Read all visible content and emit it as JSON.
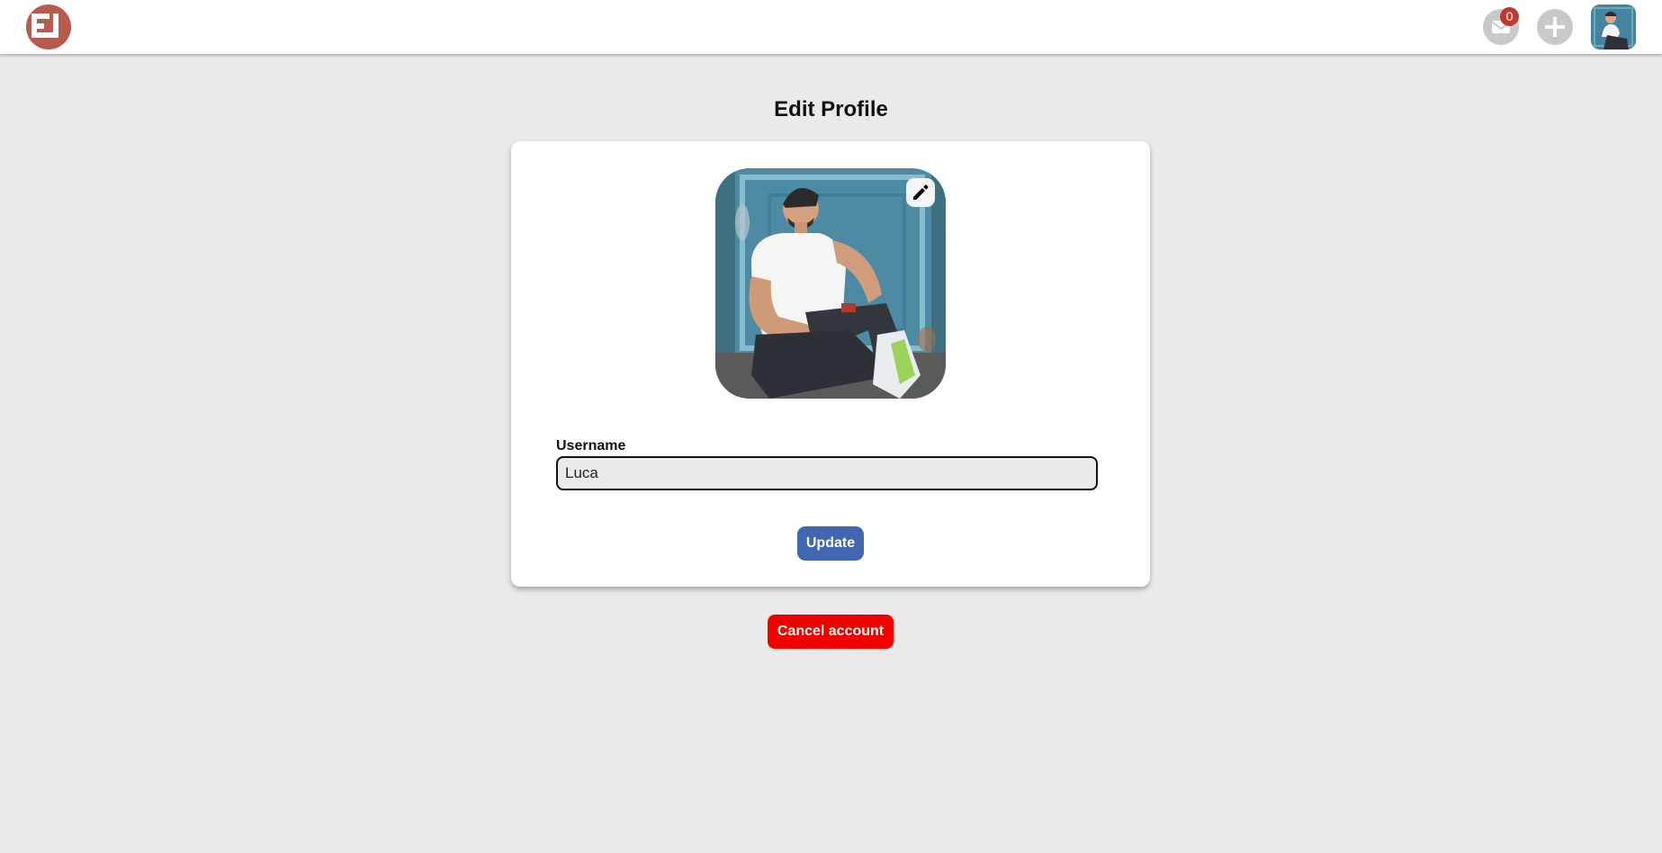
{
  "header": {
    "logo_icon": "brand-logo-icon",
    "brand_color": "#b85a4e",
    "mail_icon": "mail-icon",
    "unread_count": "0",
    "add_icon": "plus-icon",
    "avatar_icon": "user-avatar"
  },
  "page": {
    "title": "Edit Profile"
  },
  "profile_form": {
    "photo_edit_icon": "pencil-icon",
    "username_label": "Username",
    "username_value": "Luca",
    "update_label": "Update",
    "update_color": "#4267b2"
  },
  "account": {
    "cancel_label": "Cancel account",
    "cancel_color": "#f20000"
  }
}
